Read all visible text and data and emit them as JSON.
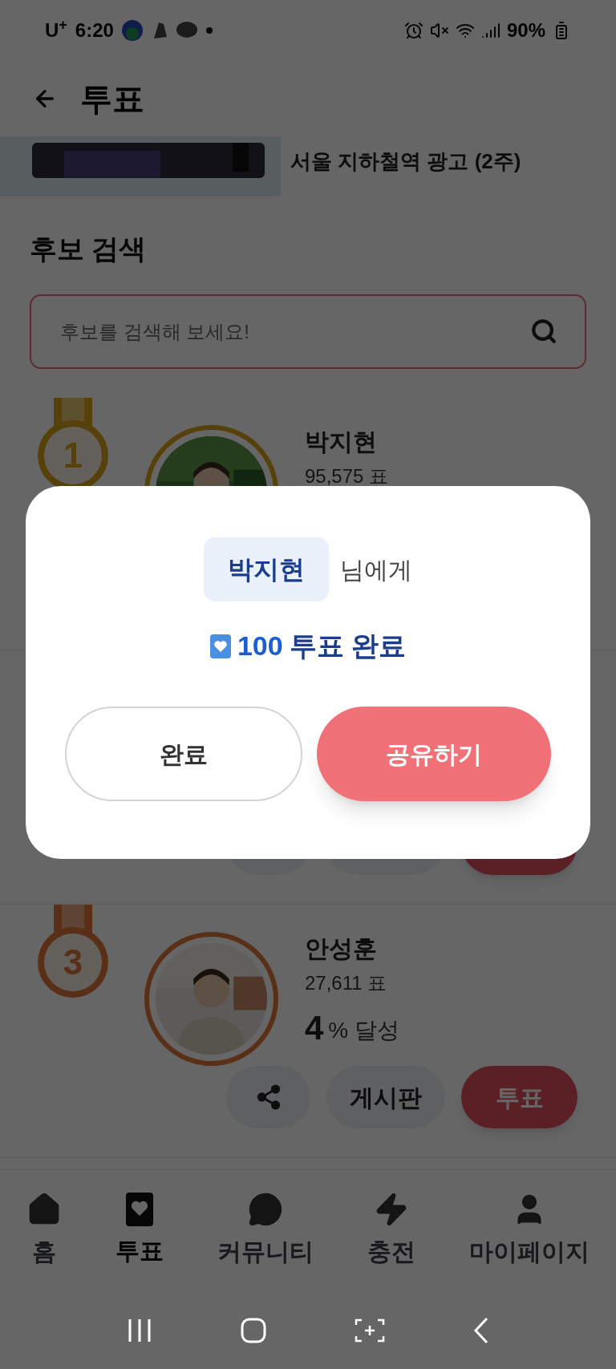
{
  "status_bar": {
    "carrier": "U$^{+}$",
    "time": "6:20",
    "battery": "90%"
  },
  "header": {
    "title": "투표"
  },
  "banner": {
    "caption": "서울 지하철역 광고 (2주)"
  },
  "search": {
    "title": "후보 검색",
    "placeholder": "후보를 검색해 보세요!"
  },
  "candidates": [
    {
      "rank": "1",
      "name": "박지현",
      "votes": "95,575 표"
    },
    {
      "rank": "3",
      "name": "안성훈",
      "votes": "27,611 표",
      "percent": "4",
      "percent_label": "% 달성",
      "board_button": "게시판",
      "vote_button": "투표"
    }
  ],
  "modal": {
    "recipient": "박지현",
    "recipient_suffix": "님에게",
    "amount": "100",
    "result": "투표 완료",
    "buttons": [
      {
        "label": "완료",
        "kind": "outline"
      },
      {
        "label": "공유하기",
        "kind": "primary"
      }
    ]
  },
  "bottom_nav": [
    {
      "label": "홈",
      "selected": false
    },
    {
      "label": "투표",
      "selected": true
    },
    {
      "label": "커뮤니티",
      "selected": false
    },
    {
      "label": "충전",
      "selected": false
    },
    {
      "label": "마이페이지",
      "selected": false
    }
  ]
}
